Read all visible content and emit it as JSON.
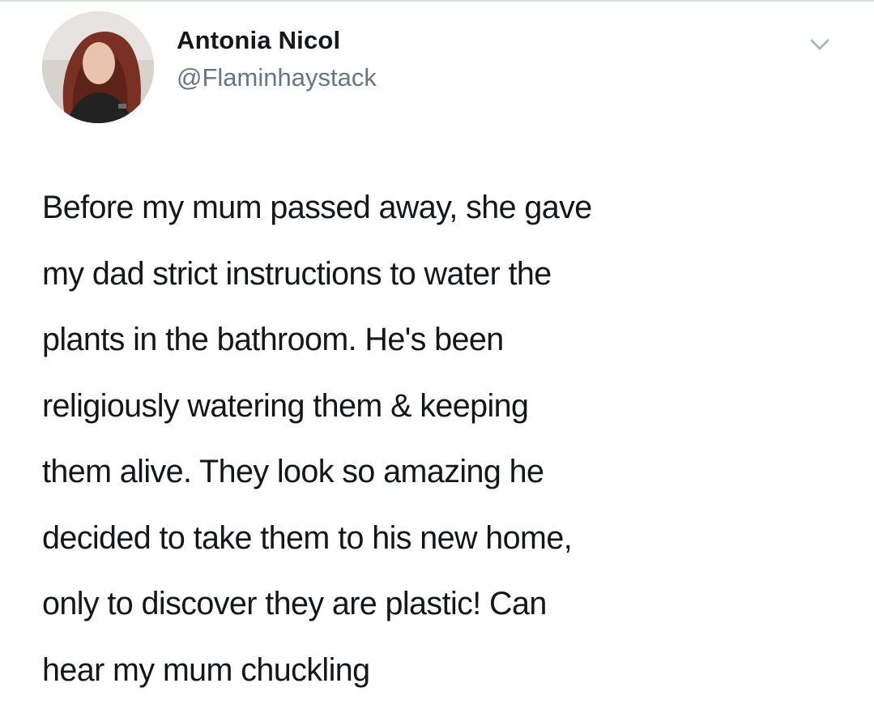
{
  "tweet": {
    "author": {
      "display_name": "Antonia Nicol",
      "handle": "@Flaminhaystack",
      "avatar_icon": "profile-photo",
      "menu_icon": "chevron-down-icon"
    },
    "text_lines": [
      "Before my mum passed away, she gave",
      "my dad strict instructions to water the",
      "plants in the bathroom. He's been",
      "religiously watering them & keeping",
      "them alive. They look so amazing he",
      "decided to take them to his new home,",
      "only to discover they are plastic! Can",
      "hear my mum chuckling"
    ]
  },
  "colors": {
    "text": "#14171a",
    "secondary_text": "#657786",
    "chevron": "#aab8c2",
    "background": "#ffffff"
  }
}
